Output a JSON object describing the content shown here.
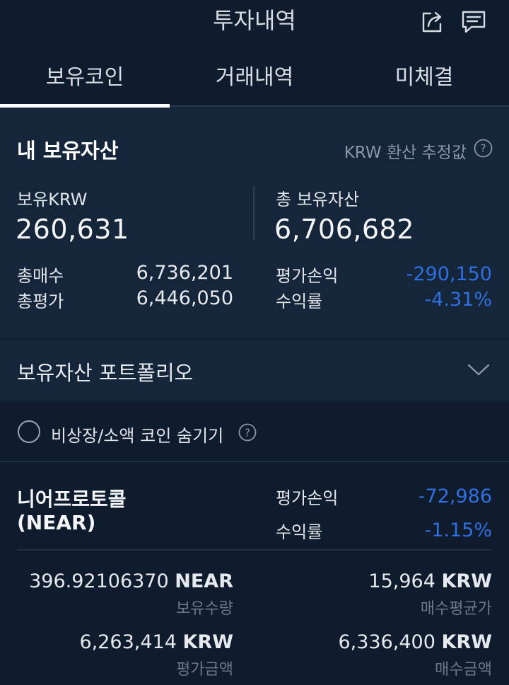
{
  "header": {
    "title": "투자내역",
    "share_icon": "share-icon",
    "chat_icon": "chat-icon"
  },
  "tabs": [
    {
      "label": "보유코인",
      "active": true
    },
    {
      "label": "거래내역",
      "active": false
    },
    {
      "label": "미체결",
      "active": false
    }
  ],
  "summary": {
    "title": "내 보유자산",
    "note": "KRW 환산 추정값",
    "krw_label": "보유KRW",
    "krw_value": "260,631",
    "total_label": "총 보유자산",
    "total_value": "6,706,682",
    "buy_label": "총매수",
    "buy_value": "6,736,201",
    "eval_label": "총평가",
    "eval_value": "6,446,050",
    "pl_label": "평가손익",
    "pl_value": "-290,150",
    "rate_label": "수익률",
    "rate_value": "-4.31%"
  },
  "portfolio": {
    "label": "보유자산 포트폴리오"
  },
  "filter": {
    "label": "비상장/소액 코인 숨기기",
    "checked": false
  },
  "holding": {
    "name": "니어프로토콜",
    "symbol": "(NEAR)",
    "pl_label": "평가손익",
    "pl_value": "-72,986",
    "rate_label": "수익률",
    "rate_value": "-1.15%",
    "qty_value": "396.92106370",
    "qty_unit": "NEAR",
    "qty_label": "보유수량",
    "avg_value": "15,964",
    "avg_unit": "KRW",
    "avg_label": "매수평균가",
    "eval_value": "6,263,414",
    "eval_unit": "KRW",
    "eval_label": "평가금액",
    "buy_value": "6,336,400",
    "buy_unit": "KRW",
    "buy_label": "매수금액"
  },
  "colors": {
    "background": "#0f1c2e",
    "panel": "#16263a",
    "negative": "#2f6fe0"
  }
}
